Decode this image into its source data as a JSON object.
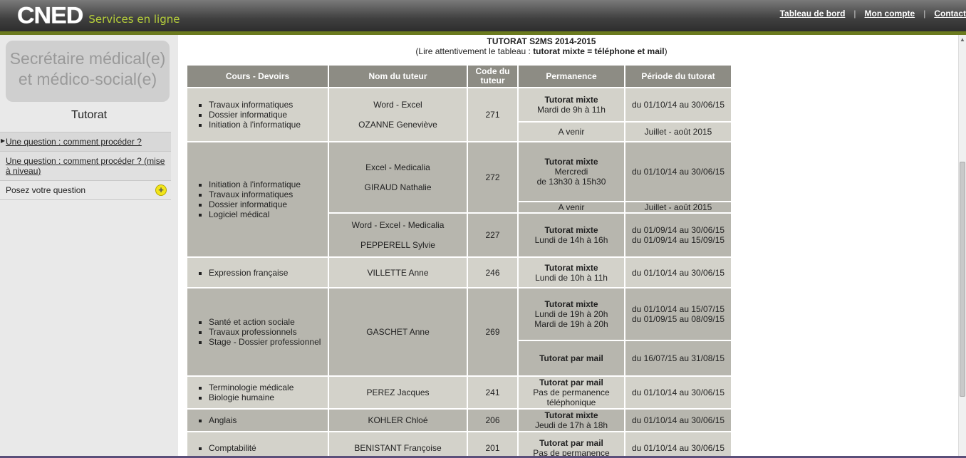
{
  "header": {
    "logo_text": "CNED",
    "logo_subtitle": "Services en ligne",
    "links": [
      "Tableau de bord",
      "Mon compte",
      "Contact"
    ]
  },
  "sidebar": {
    "course_title_line1": "Secrétaire médical(e)",
    "course_title_line2": "et médico-social(e)",
    "section_title": "Tutorat",
    "items": [
      {
        "label": "Une question : comment procéder ?"
      },
      {
        "label": "Une question : comment procéder ? (mise à niveau)"
      },
      {
        "label": "Posez votre question"
      }
    ]
  },
  "main": {
    "title": "TUTORAT S2MS 2014-2015",
    "subtitle_prefix": "(Lire attentivement le tableau : ",
    "subtitle_bold": "tutorat mixte = téléphone et mail",
    "subtitle_suffix": ")",
    "headers": [
      "Cours - Devoirs",
      "Nom du tuteur",
      "Code du tuteur",
      "Permanence",
      "Période du tutorat"
    ],
    "rows": {
      "r1": {
        "courses": [
          "Travaux informatiques",
          "Dossier informatique",
          "Initiation à l'informatique"
        ],
        "subject": "Word - Excel",
        "tutor": "OZANNE Geneviève",
        "code": "271",
        "perm1_bold": "Tutorat mixte",
        "perm1": "Mardi de 9h à 11h",
        "period1": "du 01/10/14 au 30/06/15",
        "perm2": "A venir",
        "period2": "Juillet - août 2015"
      },
      "r2": {
        "courses": [
          "Initiation à l'informatique",
          "Travaux informatiques",
          "Dossier informatique",
          "Logiciel médical"
        ],
        "subject": "Excel - Medicalia",
        "tutor": "GIRAUD Nathalie",
        "code": "272",
        "perm1_bold": "Tutorat mixte",
        "perm1a": "Mercredi",
        "perm1b": "de 13h30 à 15h30",
        "period1": "du 01/10/14 au 30/06/15",
        "perm2": "A venir",
        "period2": "Juillet - août 2015"
      },
      "r3": {
        "subject": "Word - Excel - Medicalia",
        "tutor": "PEPPERELL Sylvie",
        "code": "227",
        "perm_bold": "Tutorat mixte",
        "perm": "Lundi de 14h à 16h",
        "period_a": "du 01/09/14 au 30/06/15",
        "period_b": "du 01/09/14 au 15/09/15"
      },
      "r4": {
        "courses": [
          "Expression française"
        ],
        "tutor": "VILLETTE Anne",
        "code": "246",
        "perm_bold": "Tutorat mixte",
        "perm": "Lundi de 10h à 11h",
        "period": "du 01/10/14 au 30/06/15"
      },
      "r5": {
        "courses": [
          "Santé et action sociale",
          "Travaux professionnels",
          "Stage - Dossier professionnel"
        ],
        "tutor": "GASCHET Anne",
        "code": "269",
        "perm1_bold": "Tutorat mixte",
        "perm1a": "Lundi de 19h à 20h",
        "perm1b": "Mardi de 19h à 20h",
        "period1a": "du 01/10/14 au 15/07/15",
        "period1b": "du 01/09/15 au 08/09/15",
        "perm2_bold": "Tutorat par mail",
        "period2": "du 16/07/15 au 31/08/15"
      },
      "r6": {
        "courses": [
          "Terminologie médicale",
          "Biologie humaine"
        ],
        "tutor": "PEREZ Jacques",
        "code": "241",
        "perm_bold": "Tutorat par mail",
        "perm_a": "Pas de permanence",
        "perm_b": "téléphonique",
        "period": "du 01/10/14 au 30/06/15"
      },
      "r7": {
        "courses": [
          "Anglais"
        ],
        "tutor": "KOHLER Chloé",
        "code": "206",
        "perm_bold": "Tutorat mixte",
        "perm": "Jeudi de 17h à 18h",
        "period": "du 01/10/14 au 30/06/15"
      },
      "r8": {
        "courses": [
          "Comptabilité"
        ],
        "tutor": "BENISTANT Françoise",
        "code": "201",
        "perm_bold": "Tutorat par mail",
        "perm": "Pas de permanence",
        "period": "du 01/10/14 au 30/06/15"
      }
    }
  },
  "colors": {
    "header_bg": "#3f3f3f",
    "accent_green": "#b6cf3a",
    "stripe": "#6b7a1e",
    "table_header": "#8d8c84",
    "cell_light": "#d3d2ca",
    "cell_dark": "#b7b6ae"
  }
}
